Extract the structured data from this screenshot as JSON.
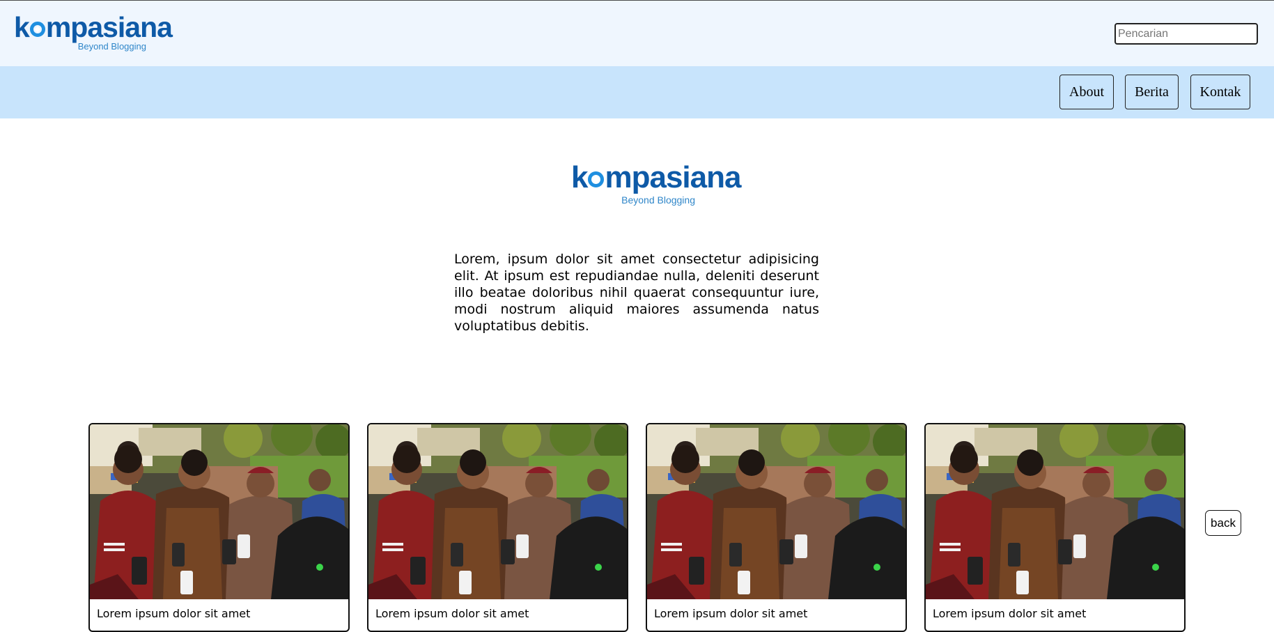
{
  "header": {
    "logo": {
      "wordmark_before": "k",
      "wordmark_after": "mpasiana",
      "tagline": "Beyond Blogging"
    },
    "search": {
      "placeholder": "Pencarian",
      "value": ""
    }
  },
  "nav": {
    "items": [
      {
        "label": "About"
      },
      {
        "label": "Berita"
      },
      {
        "label": "Kontak"
      }
    ]
  },
  "hero": {
    "logo": {
      "wordmark_before": "k",
      "wordmark_after": "mpasiana",
      "tagline": "Beyond Blogging"
    },
    "text": "Lorem, ipsum dolor sit amet consectetur adipisicing elit. At ipsum est repudiandae nulla, deleniti deserunt illo beatae doloribus nihil quaerat consequuntur iure, modi nostrum aliquid maiores assumenda natus voluptatibus debitis."
  },
  "cards": [
    {
      "image": "photo-press-interview",
      "caption": "Lorem ipsum dolor sit amet"
    },
    {
      "image": "photo-press-interview",
      "caption": "Lorem ipsum dolor sit amet"
    },
    {
      "image": "photo-press-interview",
      "caption": "Lorem ipsum dolor sit amet"
    },
    {
      "image": "photo-press-interview",
      "caption": "Lorem ipsum dolor sit amet"
    }
  ],
  "back_button": {
    "label": "back"
  },
  "colors": {
    "topbar_bg": "#eff6fe",
    "navbar_bg": "#c8e4fc",
    "brand_blue": "#0e5aa7",
    "brand_light_blue": "#1f8fe0"
  }
}
